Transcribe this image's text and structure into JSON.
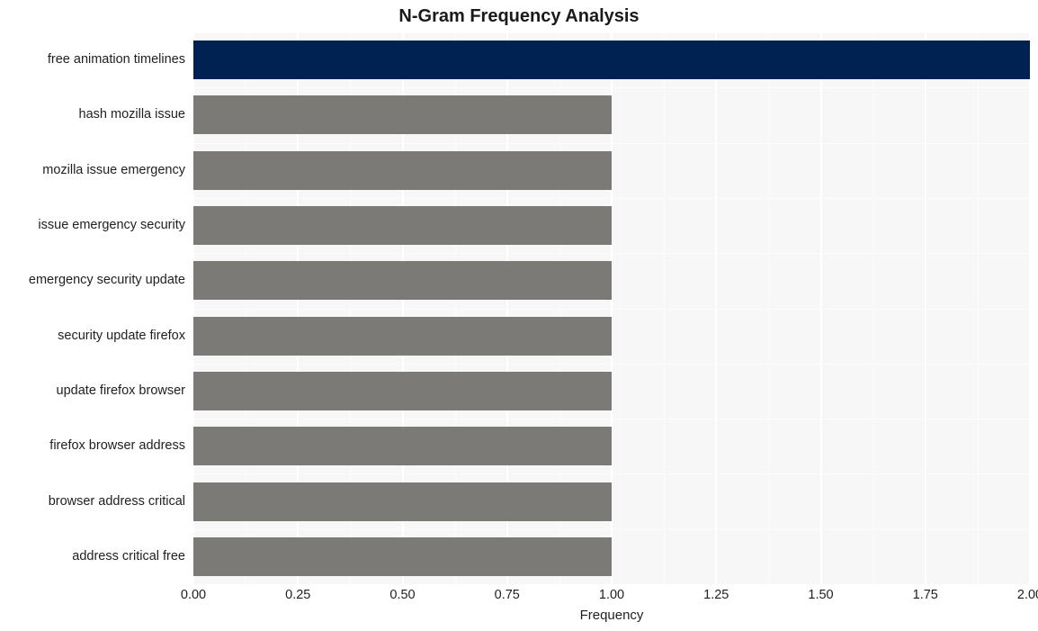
{
  "chart_data": {
    "type": "bar",
    "orientation": "horizontal",
    "title": "N-Gram Frequency Analysis",
    "xlabel": "Frequency",
    "ylabel": "",
    "categories": [
      "free animation timelines",
      "hash mozilla issue",
      "mozilla issue emergency",
      "issue emergency security",
      "emergency security update",
      "security update firefox",
      "update firefox browser",
      "firefox browser address",
      "browser address critical",
      "address critical free"
    ],
    "values": [
      2,
      1,
      1,
      1,
      1,
      1,
      1,
      1,
      1,
      1
    ],
    "bar_colors": [
      "#002253",
      "#7b7a77",
      "#7b7a77",
      "#7b7a77",
      "#7b7a77",
      "#7b7a77",
      "#7b7a77",
      "#7b7a77",
      "#7b7a77",
      "#7b7a77"
    ],
    "xlim": [
      0,
      2.0
    ],
    "xticks": [
      0.0,
      0.25,
      0.5,
      0.75,
      1.0,
      1.25,
      1.5,
      1.75,
      2.0
    ],
    "xtick_labels": [
      "0.00",
      "0.25",
      "0.50",
      "0.75",
      "1.00",
      "1.25",
      "1.50",
      "1.75",
      "2.00"
    ],
    "grid": true,
    "legend": null,
    "plot_background": "#f7f7f7",
    "grid_color": "#ffffff",
    "figure_background": "#ffffff"
  }
}
